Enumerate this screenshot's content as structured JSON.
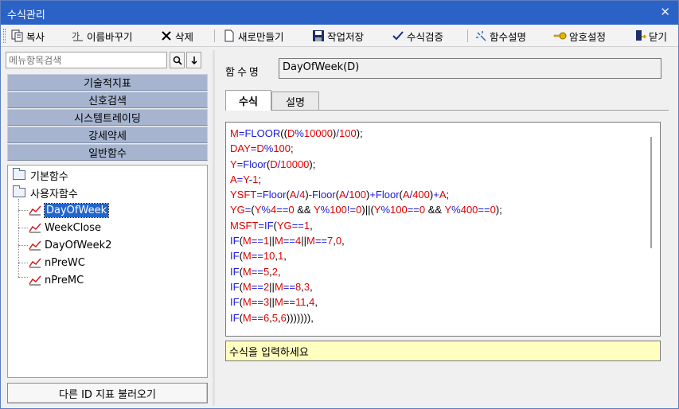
{
  "window": {
    "title": "수식관리",
    "close_glyph": "✕"
  },
  "toolbar": {
    "copy": {
      "label": "복사",
      "icon": "copy-icon"
    },
    "rename": {
      "label": "이름바꾸기",
      "icon": "rename-icon"
    },
    "delete": {
      "label": "삭제",
      "icon": "x-icon"
    },
    "new": {
      "label": "새로만들기",
      "icon": "new-document-icon"
    },
    "save": {
      "label": "작업저장",
      "icon": "floppy-disk-icon"
    },
    "verify": {
      "label": "수식검증",
      "icon": "check-icon"
    },
    "help": {
      "label": "함수설명",
      "icon": "sparkle-icon"
    },
    "password": {
      "label": "암호설정",
      "icon": "key-icon"
    },
    "close": {
      "label": "닫기",
      "icon": "exit-door-icon"
    }
  },
  "search": {
    "placeholder": "메뉴항목검색"
  },
  "categories": [
    "기술적지표",
    "신호검색",
    "시스템트레이딩",
    "강세약세",
    "일반함수"
  ],
  "tree": {
    "folders": [
      "기본함수",
      "사용자함수"
    ],
    "items": [
      "DayOfWeek",
      "WeekClose",
      "DayOfWeek2",
      "nPreWC",
      "nPreMC"
    ],
    "selected_index": 0
  },
  "load_other_button": "다른 ID 지표 불러오기",
  "function_name": {
    "label": "함수명",
    "value": "DayOfWeek(D)"
  },
  "tabs": [
    "수식",
    "설명"
  ],
  "active_tab": 0,
  "code_lines": [
    [
      [
        "r",
        "M"
      ],
      [
        "b",
        "="
      ],
      [
        "b",
        "FLOOR"
      ],
      [
        "k",
        "(("
      ],
      [
        "r",
        "D"
      ],
      [
        "b",
        "%"
      ],
      [
        "r",
        "10000"
      ],
      [
        "k",
        ")"
      ],
      [
        "b",
        "/"
      ],
      [
        "r",
        "100"
      ],
      [
        "k",
        ");"
      ]
    ],
    [
      [
        "r",
        "DAY"
      ],
      [
        "b",
        "="
      ],
      [
        "r",
        "D"
      ],
      [
        "b",
        "%"
      ],
      [
        "r",
        "100"
      ],
      [
        "k",
        ";"
      ]
    ],
    [
      [
        "r",
        "Y"
      ],
      [
        "b",
        "="
      ],
      [
        "b",
        "Floor"
      ],
      [
        "k",
        "("
      ],
      [
        "r",
        "D"
      ],
      [
        "b",
        "/"
      ],
      [
        "r",
        "10000"
      ],
      [
        "k",
        ");"
      ]
    ],
    [
      [
        "r",
        "A"
      ],
      [
        "b",
        "="
      ],
      [
        "r",
        "Y"
      ],
      [
        "b",
        "-"
      ],
      [
        "r",
        "1"
      ],
      [
        "k",
        ";"
      ]
    ],
    [
      [
        "r",
        "YSFT"
      ],
      [
        "b",
        "="
      ],
      [
        "b",
        "Floor"
      ],
      [
        "k",
        "("
      ],
      [
        "r",
        "A"
      ],
      [
        "b",
        "/"
      ],
      [
        "r",
        "4"
      ],
      [
        "k",
        ")"
      ],
      [
        "b",
        "-"
      ],
      [
        "b",
        "Floor"
      ],
      [
        "k",
        "("
      ],
      [
        "r",
        "A"
      ],
      [
        "b",
        "/"
      ],
      [
        "r",
        "100"
      ],
      [
        "k",
        ")"
      ],
      [
        "b",
        "+"
      ],
      [
        "b",
        "Floor"
      ],
      [
        "k",
        "("
      ],
      [
        "r",
        "A"
      ],
      [
        "b",
        "/"
      ],
      [
        "r",
        "400"
      ],
      [
        "k",
        ")"
      ],
      [
        "b",
        "+"
      ],
      [
        "r",
        "A"
      ],
      [
        "k",
        ";"
      ]
    ],
    [
      [
        "r",
        "YG"
      ],
      [
        "b",
        "="
      ],
      [
        "k",
        "("
      ],
      [
        "r",
        "Y"
      ],
      [
        "b",
        "%"
      ],
      [
        "r",
        "4"
      ],
      [
        "b",
        "=="
      ],
      [
        "r",
        "0"
      ],
      [
        "k",
        " && "
      ],
      [
        "r",
        "Y"
      ],
      [
        "b",
        "%"
      ],
      [
        "r",
        "100"
      ],
      [
        "b",
        "!="
      ],
      [
        "r",
        "0"
      ],
      [
        "k",
        ")||("
      ],
      [
        "r",
        "Y"
      ],
      [
        "b",
        "%"
      ],
      [
        "r",
        "100"
      ],
      [
        "b",
        "=="
      ],
      [
        "r",
        "0"
      ],
      [
        "k",
        " && "
      ],
      [
        "r",
        "Y"
      ],
      [
        "b",
        "%"
      ],
      [
        "r",
        "400"
      ],
      [
        "b",
        "=="
      ],
      [
        "r",
        "0"
      ],
      [
        "k",
        ");"
      ]
    ],
    [
      [
        "r",
        "MSFT"
      ],
      [
        "b",
        "="
      ],
      [
        "b",
        "IF"
      ],
      [
        "k",
        "("
      ],
      [
        "r",
        "YG"
      ],
      [
        "b",
        "=="
      ],
      [
        "r",
        "1"
      ],
      [
        "k",
        ","
      ]
    ],
    [
      [
        "b",
        "IF"
      ],
      [
        "k",
        "("
      ],
      [
        "r",
        "M"
      ],
      [
        "b",
        "=="
      ],
      [
        "r",
        "1"
      ],
      [
        "k",
        "||"
      ],
      [
        "r",
        "M"
      ],
      [
        "b",
        "=="
      ],
      [
        "r",
        "4"
      ],
      [
        "k",
        "||"
      ],
      [
        "r",
        "M"
      ],
      [
        "b",
        "=="
      ],
      [
        "r",
        "7"
      ],
      [
        "k",
        ","
      ],
      [
        "r",
        "0"
      ],
      [
        "k",
        ","
      ]
    ],
    [
      [
        "b",
        "IF"
      ],
      [
        "k",
        "("
      ],
      [
        "r",
        "M"
      ],
      [
        "b",
        "=="
      ],
      [
        "r",
        "10"
      ],
      [
        "k",
        ","
      ],
      [
        "r",
        "1"
      ],
      [
        "k",
        ","
      ]
    ],
    [
      [
        "b",
        "IF"
      ],
      [
        "k",
        "("
      ],
      [
        "r",
        "M"
      ],
      [
        "b",
        "=="
      ],
      [
        "r",
        "5"
      ],
      [
        "k",
        ","
      ],
      [
        "r",
        "2"
      ],
      [
        "k",
        ","
      ]
    ],
    [
      [
        "b",
        "IF"
      ],
      [
        "k",
        "("
      ],
      [
        "r",
        "M"
      ],
      [
        "b",
        "=="
      ],
      [
        "r",
        "2"
      ],
      [
        "k",
        "||"
      ],
      [
        "r",
        "M"
      ],
      [
        "b",
        "=="
      ],
      [
        "r",
        "8"
      ],
      [
        "k",
        ","
      ],
      [
        "r",
        "3"
      ],
      [
        "k",
        ","
      ]
    ],
    [
      [
        "b",
        "IF"
      ],
      [
        "k",
        "("
      ],
      [
        "r",
        "M"
      ],
      [
        "b",
        "=="
      ],
      [
        "r",
        "3"
      ],
      [
        "k",
        "||"
      ],
      [
        "r",
        "M"
      ],
      [
        "b",
        "=="
      ],
      [
        "r",
        "11"
      ],
      [
        "k",
        ","
      ],
      [
        "r",
        "4"
      ],
      [
        "k",
        ","
      ]
    ],
    [
      [
        "b",
        "IF"
      ],
      [
        "k",
        "("
      ],
      [
        "r",
        "M"
      ],
      [
        "b",
        "=="
      ],
      [
        "r",
        "6"
      ],
      [
        "k",
        ","
      ],
      [
        "r",
        "5"
      ],
      [
        "k",
        ","
      ],
      [
        "r",
        "6"
      ],
      [
        "k",
        "))))))),"
      ]
    ]
  ],
  "status_message": "수식을 입력하세요"
}
